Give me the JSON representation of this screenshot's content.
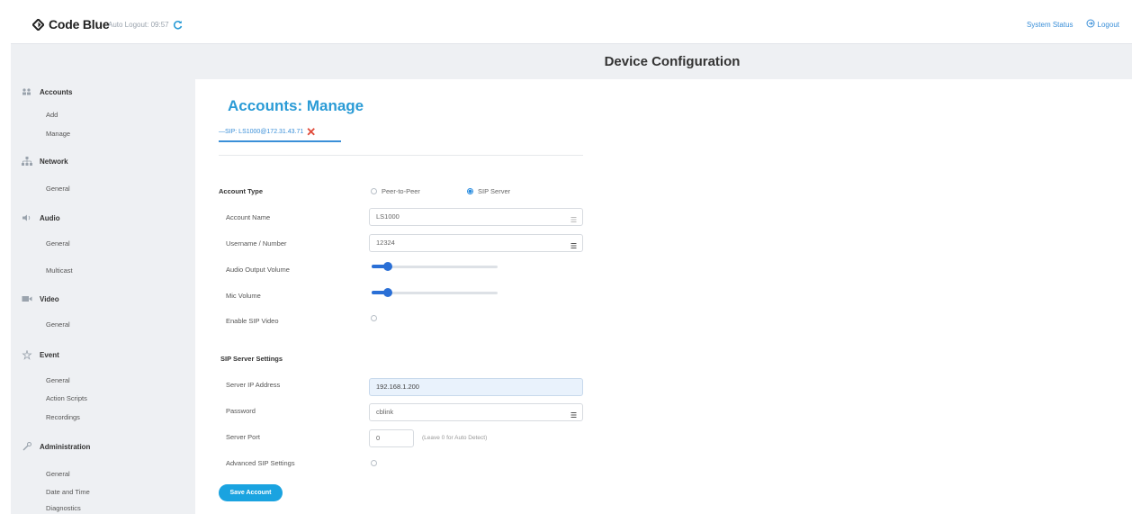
{
  "app": {
    "logo_text": "Code Blue",
    "auto_logout": "Auto Logout: 09:57",
    "system_status": "System Status",
    "logout": "Logout"
  },
  "header": {
    "title": "Device Configuration"
  },
  "sidebar": {
    "sections": [
      {
        "label": "Accounts",
        "icon": "accounts-icon",
        "items": [
          "Add",
          "Manage"
        ]
      },
      {
        "label": "Network",
        "icon": "network-icon",
        "items": [
          "General"
        ]
      },
      {
        "label": "Audio",
        "icon": "audio-icon",
        "items": [
          "General",
          "Multicast"
        ]
      },
      {
        "label": "Video",
        "icon": "video-icon",
        "items": [
          "General"
        ]
      },
      {
        "label": "Event",
        "icon": "event-icon",
        "items": [
          "General",
          "Action Scripts",
          "Recordings"
        ]
      },
      {
        "label": "Administration",
        "icon": "administration-icon",
        "items": [
          "General",
          "Date and Time",
          "Diagnostics"
        ]
      }
    ]
  },
  "main": {
    "title": "Accounts: Manage",
    "account_tab": "—SIP: LS1000@172.31.43.71",
    "account_type_label": "Account Type",
    "account_type_options": [
      "Peer-to-Peer",
      "SIP Server"
    ],
    "account_type_selected": "SIP Server",
    "account_name_label": "Account Name",
    "account_name_value": "LS1000",
    "username_label": "Username / Number",
    "username_value": "12324",
    "audio_output_label": "Audio Output Volume",
    "audio_output_level": 0.13,
    "mic_volume_label": "Mic Volume",
    "mic_volume_level": 0.13,
    "enable_video_label": "Enable SIP Video",
    "sip_settings_label": "SIP Server Settings",
    "server_ip_label": "Server IP Address",
    "server_ip_value": "192.168.1.200",
    "password_label": "Password",
    "password_value": "cblink",
    "server_port_label": "Server Port",
    "server_port_value": "0",
    "server_port_hint": "(Leave 0 for Auto Detect)",
    "advanced_label": "Advanced SIP Settings",
    "save_button": "Save Account"
  },
  "colors": {
    "accent": "#2a9bd6",
    "button": "#1aa3e0",
    "slider": "#2a6fd6",
    "remove": "#e04a3a"
  }
}
